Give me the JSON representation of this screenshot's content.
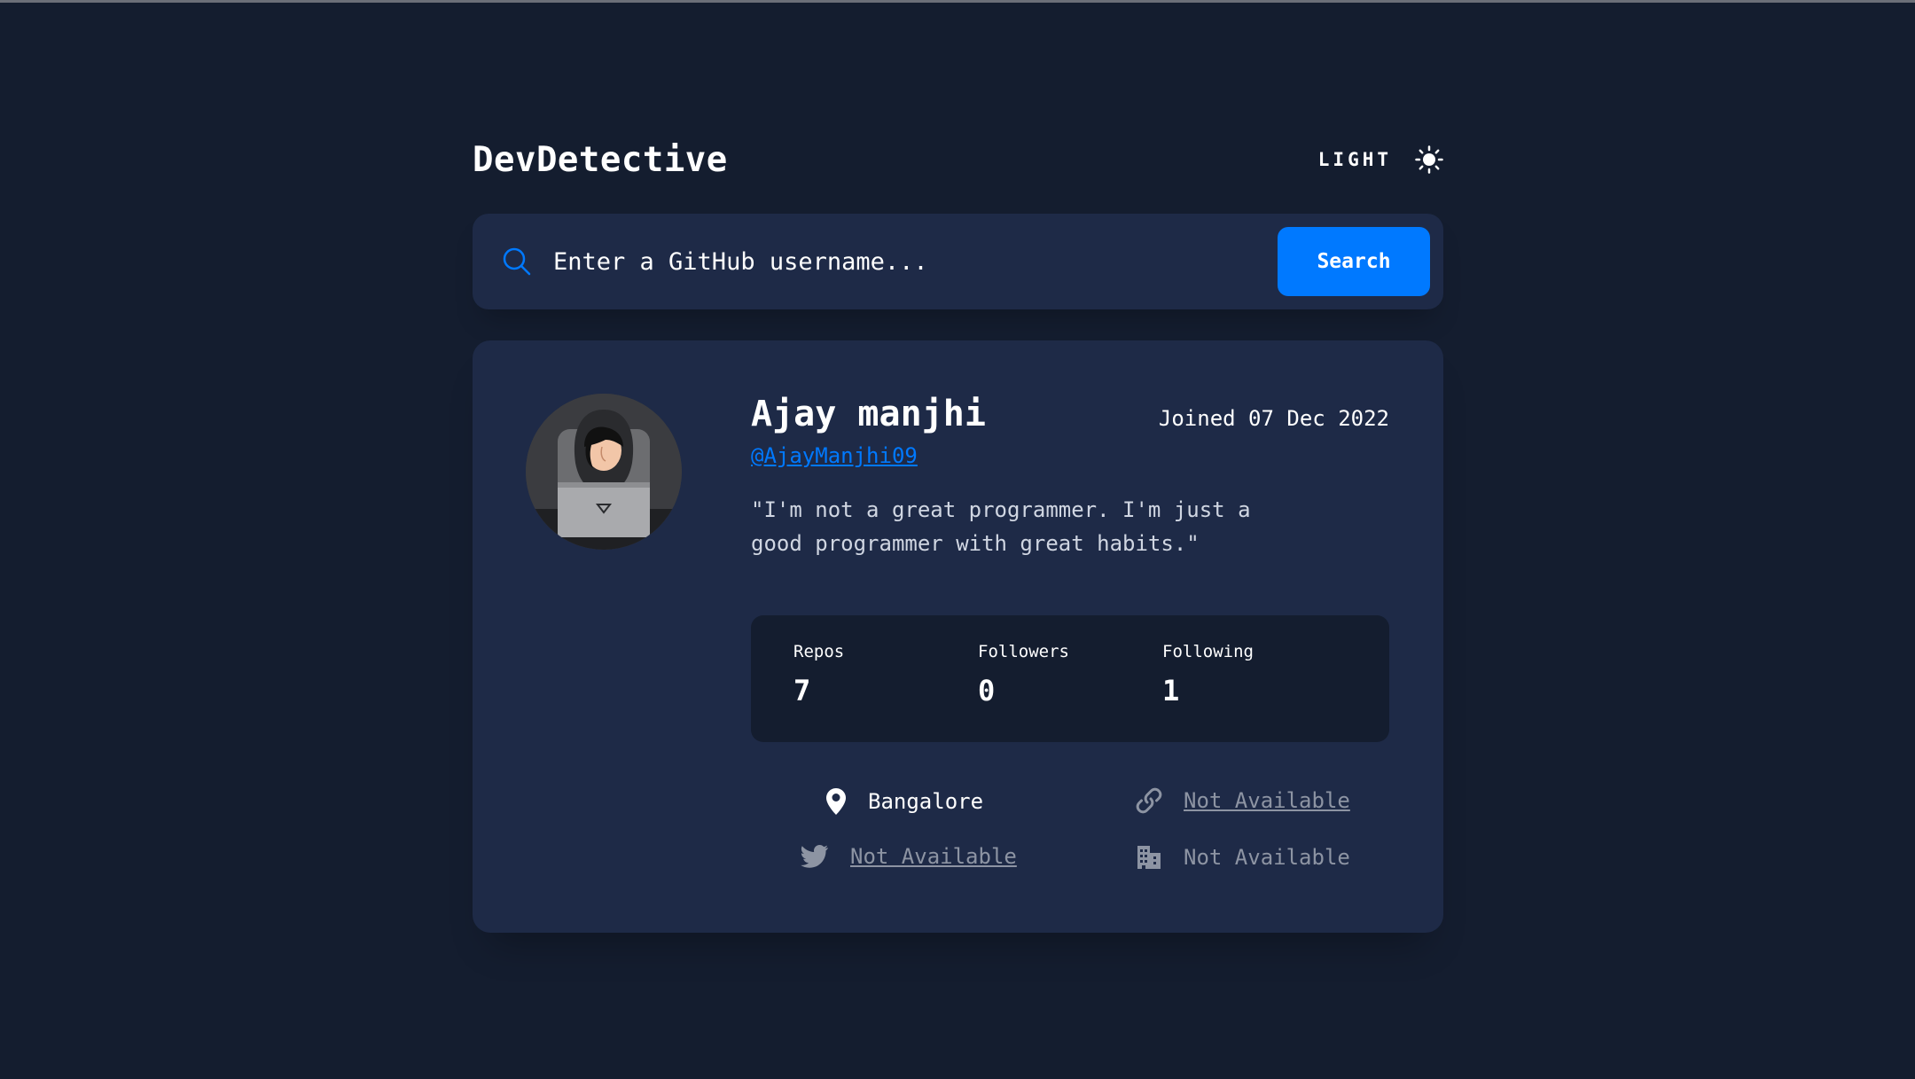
{
  "app": {
    "title": "DevDetective",
    "mode_label": "LIGHT",
    "colors": {
      "background": "#141d2f",
      "card": "#1e2a47",
      "accent": "#0079ff",
      "muted": "#8d94a3"
    }
  },
  "search": {
    "placeholder": "Enter a GitHub username...",
    "button_label": "Search"
  },
  "profile": {
    "name": "Ajay manjhi",
    "joined": "Joined 07 Dec 2022",
    "username": "@AjayManjhi09",
    "bio": "\"I'm not a great programmer. I'm just a good programmer with great habits.\"",
    "stats": [
      {
        "label": "Repos",
        "value": "7"
      },
      {
        "label": "Followers",
        "value": "0"
      },
      {
        "label": "Following",
        "value": "1"
      }
    ],
    "links": {
      "location": {
        "icon": "location-pin-icon",
        "text": "Bangalore"
      },
      "website": {
        "icon": "link-icon",
        "text": "Not Available"
      },
      "twitter": {
        "icon": "twitter-icon",
        "text": "Not Available"
      },
      "company": {
        "icon": "building-icon",
        "text": "Not Available"
      }
    }
  }
}
